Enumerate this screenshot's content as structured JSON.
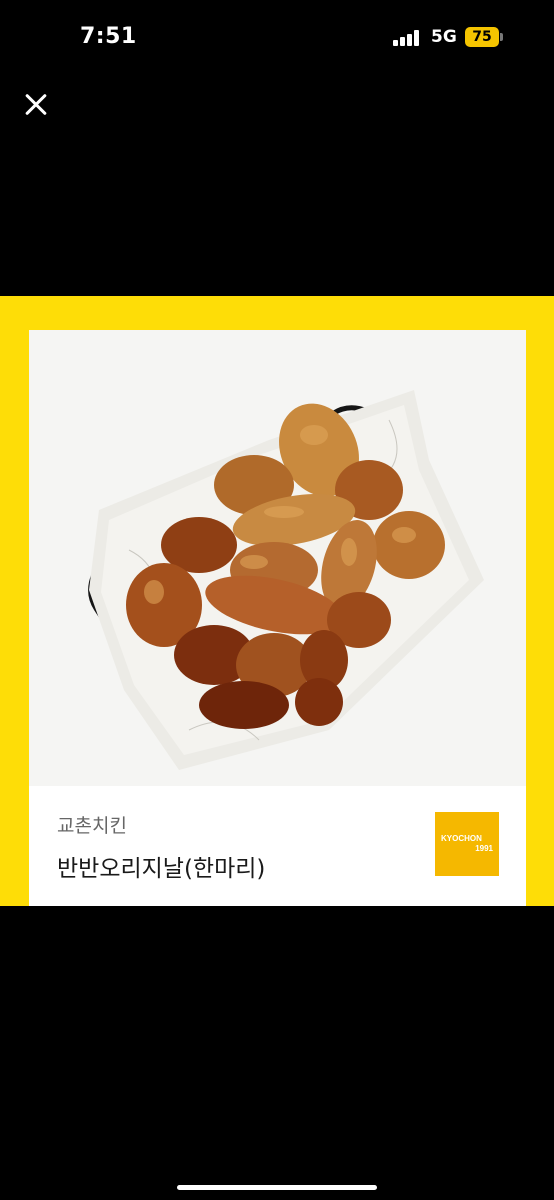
{
  "status_bar": {
    "time": "7:51",
    "network": "5G",
    "battery": "75"
  },
  "card": {
    "brand": "교촌치킨",
    "product_name": "반반오리지날(한마리)",
    "logo": {
      "line1": "KYOCHON",
      "line2": "1991"
    }
  },
  "colors": {
    "banner": "#fedd07",
    "logo": "#f5b800",
    "background": "#000000"
  },
  "icons": {
    "close": "close-icon",
    "signal": "cellular-signal-icon",
    "battery": "battery-icon"
  }
}
